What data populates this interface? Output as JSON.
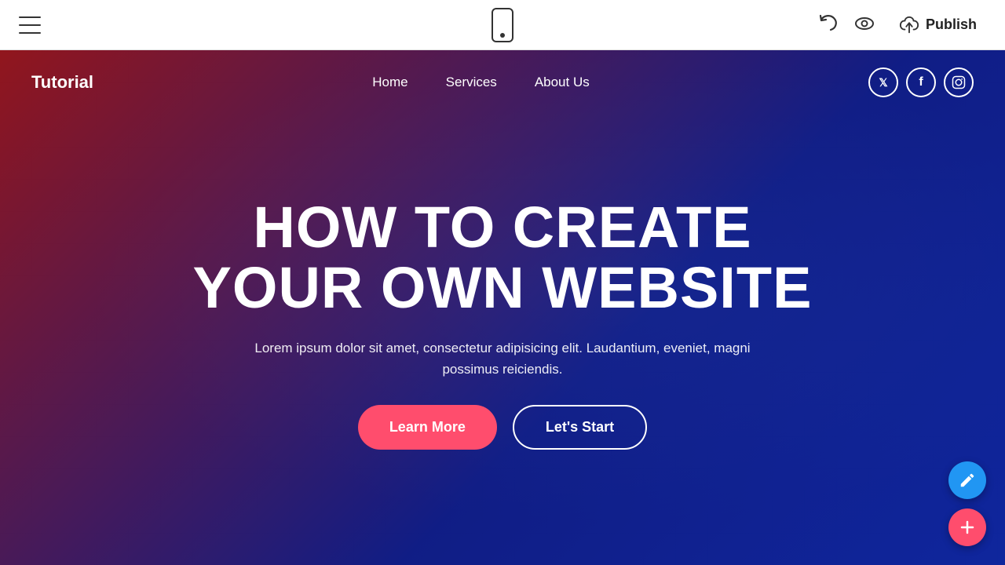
{
  "toolbar": {
    "hamburger_label": "menu",
    "phone_label": "mobile-view",
    "undo_label": "undo",
    "preview_label": "preview",
    "publish_label": "Publish"
  },
  "site": {
    "logo": "Tutorial",
    "nav": {
      "home": "Home",
      "services": "Services",
      "about_us": "About Us"
    },
    "social": {
      "twitter": "𝕏",
      "facebook": "f",
      "instagram": "📷"
    }
  },
  "hero": {
    "title_line1": "HOW TO CREATE",
    "title_line2": "YOUR OWN WEBSITE",
    "subtitle": "Lorem ipsum dolor sit amet, consectetur adipisicing elit. Laudantium, eveniet, magni possimus reiciendis.",
    "btn_learn_more": "Learn More",
    "btn_lets_start": "Let's Start"
  },
  "fab": {
    "edit_label": "edit",
    "add_label": "add"
  },
  "colors": {
    "accent_pink": "#ff4d6d",
    "accent_blue": "#2196f3"
  }
}
